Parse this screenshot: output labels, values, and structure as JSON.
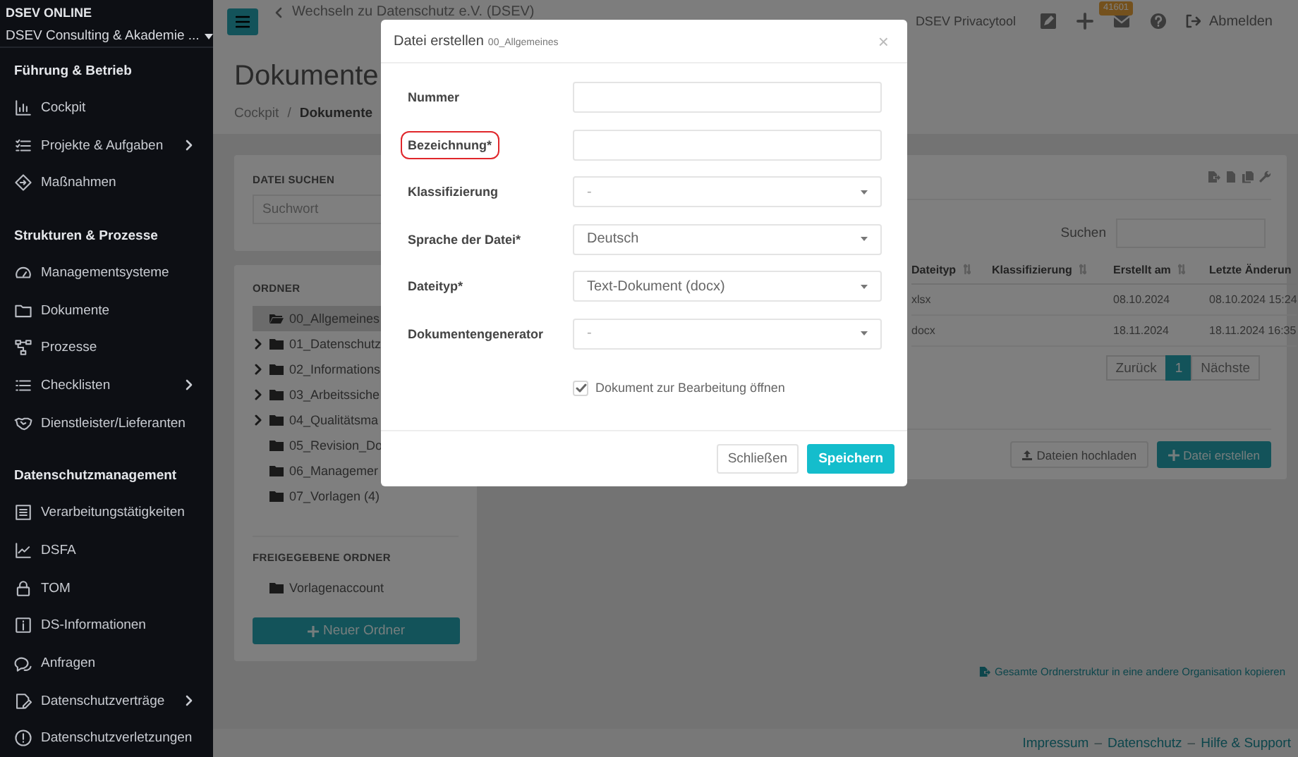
{
  "sidebar": {
    "org_label": "DSEV ONLINE",
    "org_name": "DSEV Consulting & Akademie ...",
    "sections": [
      {
        "heading": "Führung & Betrieb",
        "items": [
          {
            "label": "Cockpit",
            "submenu": false
          },
          {
            "label": "Projekte & Aufgaben",
            "submenu": true
          },
          {
            "label": "Maßnahmen",
            "submenu": false
          }
        ]
      },
      {
        "heading": "Strukturen & Prozesse",
        "items": [
          {
            "label": "Managementsysteme",
            "submenu": false
          },
          {
            "label": "Dokumente",
            "submenu": false
          },
          {
            "label": "Prozesse",
            "submenu": false
          },
          {
            "label": "Checklisten",
            "submenu": true
          },
          {
            "label": "Dienstleister/Lieferanten",
            "submenu": false
          }
        ]
      },
      {
        "heading": "Datenschutzmanagement",
        "items": [
          {
            "label": "Verarbeitungstätigkeiten",
            "submenu": false
          },
          {
            "label": "DSFA",
            "submenu": false
          },
          {
            "label": "TOM",
            "submenu": false
          },
          {
            "label": "DS-Informationen",
            "submenu": false
          },
          {
            "label": "Anfragen",
            "submenu": false
          },
          {
            "label": "Datenschutzverträge",
            "submenu": true
          },
          {
            "label": "Datenschutzverletzungen",
            "submenu": false
          }
        ]
      }
    ]
  },
  "topbar": {
    "switch_link": "Wechseln zu Datenschutz e.V. (DSEV)",
    "app_name": "DSEV Privacytool",
    "mail_badge": "41601",
    "logout": "Abmelden"
  },
  "page": {
    "title": "Dokumente",
    "breadcrumb": [
      "Cockpit",
      "Dokumente"
    ],
    "breadcrumb_separator": "/"
  },
  "file_search": {
    "heading": "DATEI SUCHEN",
    "placeholder": "Suchwort"
  },
  "folders": {
    "heading": "ORDNER",
    "items": [
      {
        "name": "00_Allgemeines",
        "selected": true,
        "expandable": false
      },
      {
        "name": "01_Datenschutz",
        "selected": false,
        "expandable": true
      },
      {
        "name": "02_Informations",
        "selected": false,
        "expandable": true
      },
      {
        "name": "03_Arbeitssiche",
        "selected": false,
        "expandable": true
      },
      {
        "name": "04_Qualitätsma",
        "selected": false,
        "expandable": true
      },
      {
        "name": "05_Revision_Do",
        "selected": false,
        "expandable": false
      },
      {
        "name": "06_Managemer",
        "selected": false,
        "expandable": false
      },
      {
        "name": "07_Vorlagen (4)",
        "selected": false,
        "expandable": false
      }
    ],
    "shared_heading": "FREIGEGEBENE ORDNER",
    "shared": [
      {
        "name": "Vorlagenaccount"
      }
    ],
    "new_button": "Neuer Ordner"
  },
  "files": {
    "search_label": "Suchen",
    "columns": [
      {
        "label": "Dateityp",
        "sortable": true
      },
      {
        "label": "Klassifizierung",
        "sortable": true
      },
      {
        "label": "Erstellt am",
        "sortable": true
      },
      {
        "label": "Letzte Änderun",
        "sortable": false
      }
    ],
    "rows": [
      [
        "xlsx",
        "",
        "08.10.2024",
        "08.10.2024 15:24"
      ],
      [
        "docx",
        "",
        "18.11.2024",
        "18.11.2024 16:35"
      ]
    ],
    "pagination": {
      "prev": "Zurück",
      "pages": [
        {
          "label": "1",
          "selected": true
        }
      ],
      "next": "Nächste"
    },
    "buttons": [
      {
        "label": "Dateien hochladen",
        "kind": "upload"
      },
      {
        "label": "Datei erstellen",
        "kind": "create"
      }
    ]
  },
  "copy_link": "Gesamte Ordnerstruktur in eine andere Organisation kopieren",
  "footer": [
    {
      "kind": "link",
      "text": "Impressum"
    },
    {
      "kind": "separator",
      "text": "–"
    },
    {
      "kind": "link",
      "text": "Datenschutz"
    },
    {
      "kind": "separator",
      "text": "–"
    },
    {
      "kind": "link",
      "text": "Hilfe & Support"
    }
  ],
  "modal": {
    "title": "Datei erstellen",
    "subtitle": "00_Allgemeines",
    "close": "×",
    "fields": [
      {
        "label": "Nummer",
        "kind": "text",
        "highlighted": false
      },
      {
        "label": "Bezeichnung*",
        "kind": "text",
        "highlighted": true
      },
      {
        "label": "Klassifizierung",
        "kind": "select",
        "placeholder": "-",
        "highlighted": false
      },
      {
        "label": "Sprache der Datei*",
        "kind": "select",
        "value": "Deutsch",
        "highlighted": false
      },
      {
        "label": "Dateityp*",
        "kind": "select",
        "value": "Text-Dokument (docx)",
        "highlighted": false
      },
      {
        "label": "Dokumentengenerator",
        "kind": "select",
        "placeholder": "-",
        "highlighted": false
      }
    ],
    "checkbox": {
      "label": "Dokument zur Bearbeitung öffnen",
      "checked": true
    },
    "buttons": [
      {
        "label": "Schließen",
        "kind": "secondary"
      },
      {
        "label": "Speichern",
        "kind": "primary"
      }
    ]
  }
}
